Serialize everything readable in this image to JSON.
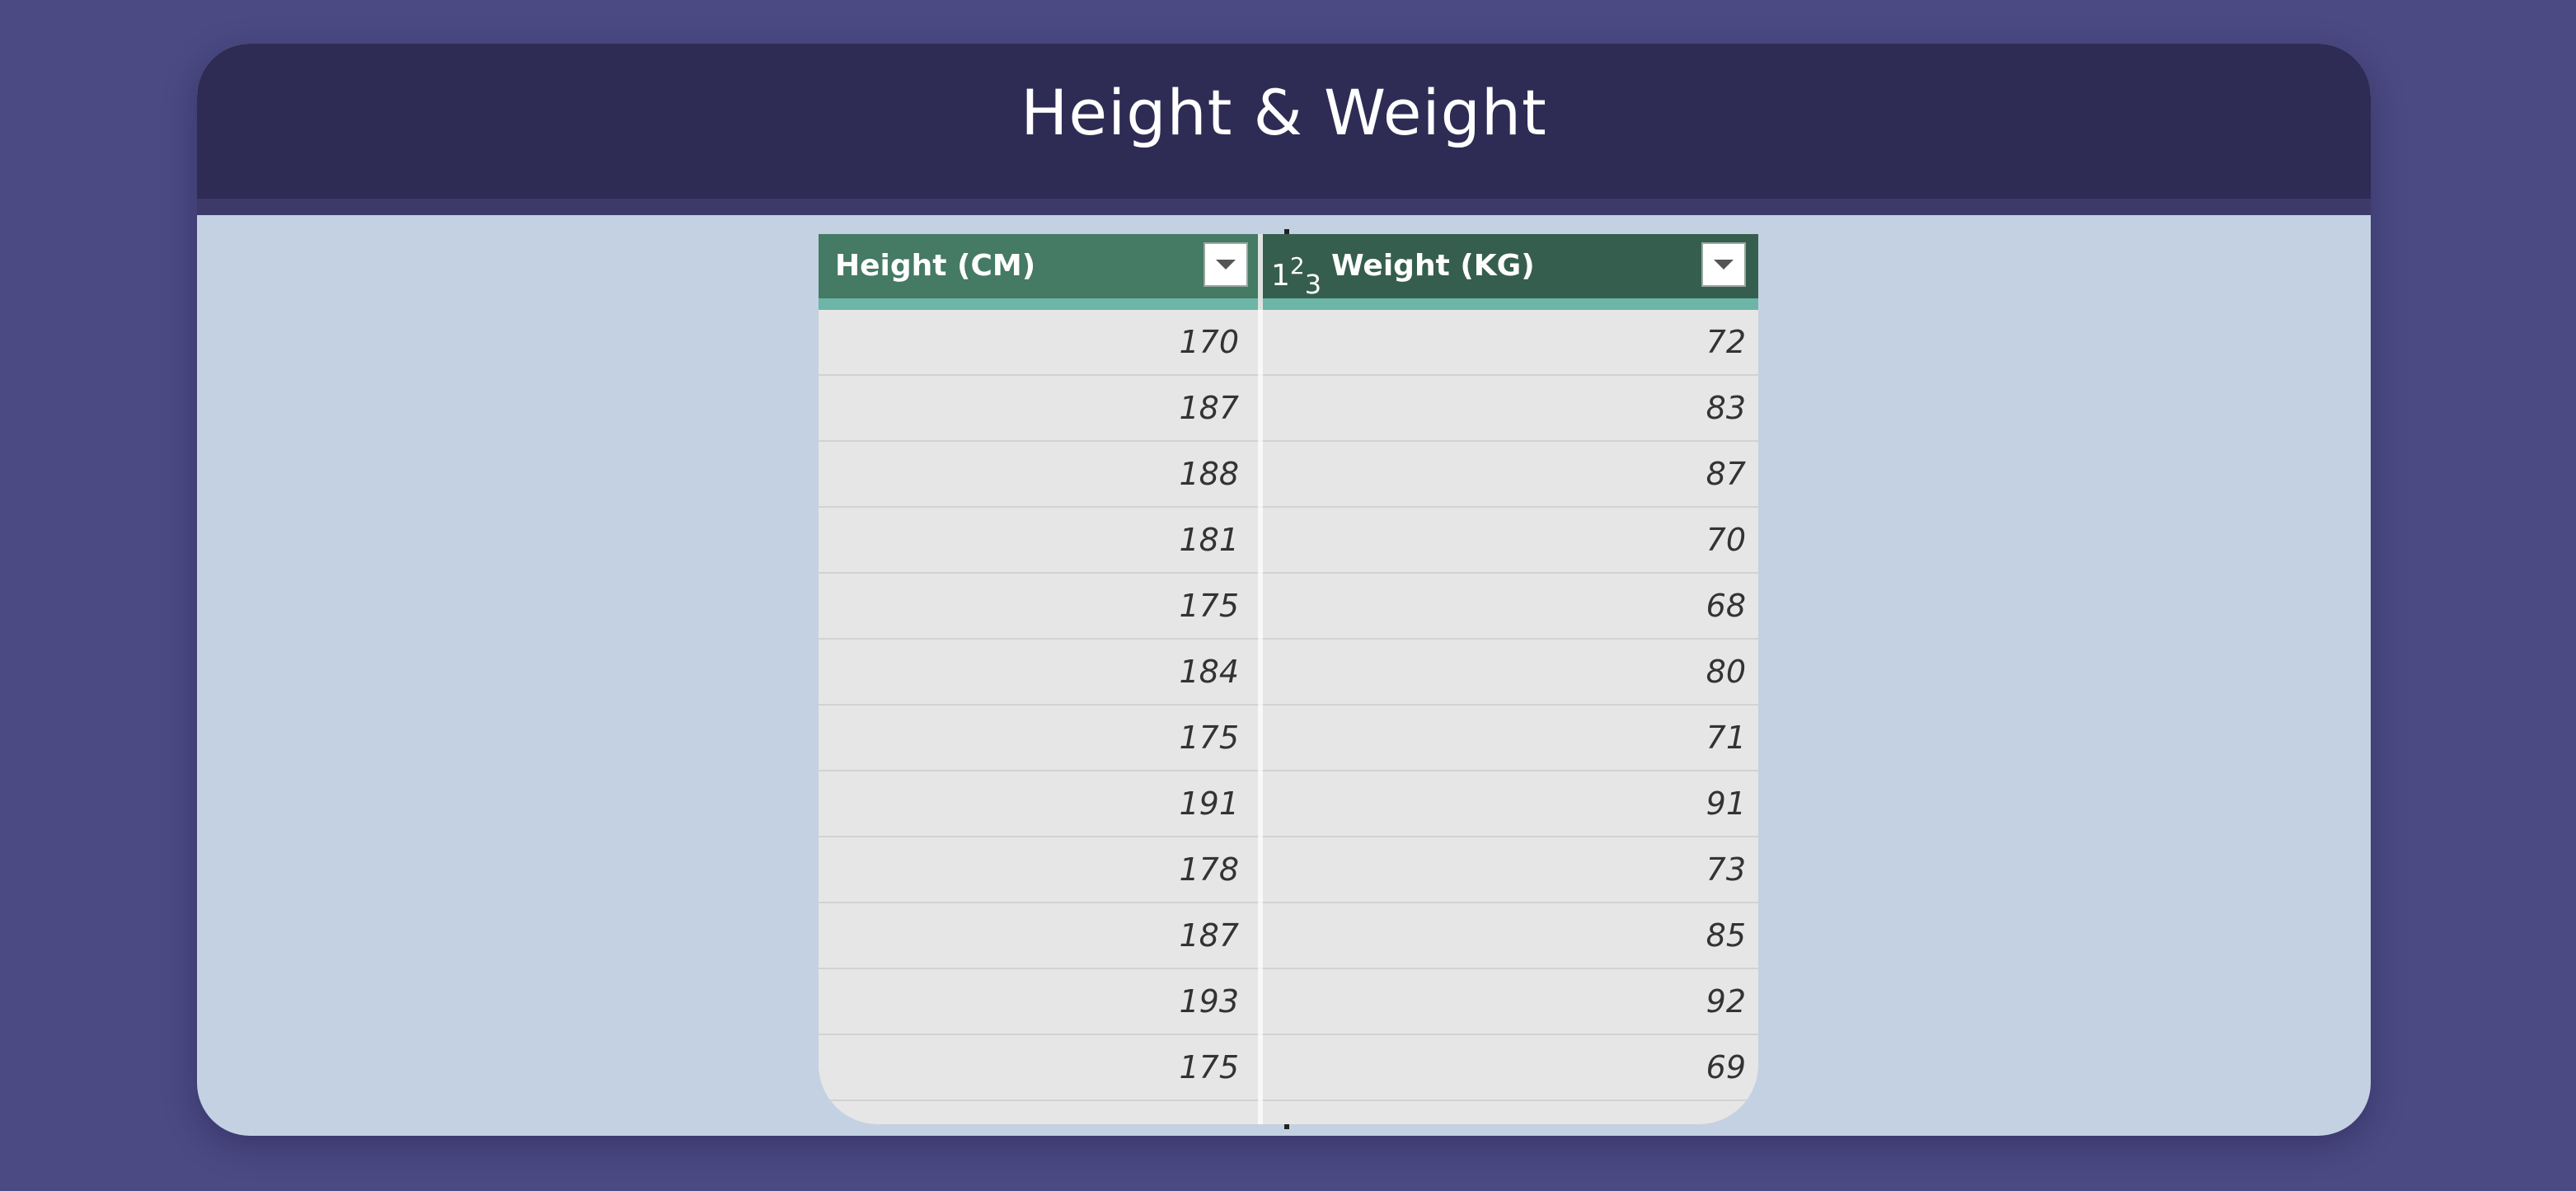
{
  "title": "Height & Weight",
  "table": {
    "columns": [
      {
        "label": "Height (CM)",
        "type_icon": ""
      },
      {
        "label": "Weight (KG)",
        "type_icon": "123"
      }
    ],
    "rows": [
      {
        "height": "170",
        "weight": "72"
      },
      {
        "height": "187",
        "weight": "83"
      },
      {
        "height": "188",
        "weight": "87"
      },
      {
        "height": "181",
        "weight": "70"
      },
      {
        "height": "175",
        "weight": "68"
      },
      {
        "height": "184",
        "weight": "80"
      },
      {
        "height": "175",
        "weight": "71"
      },
      {
        "height": "191",
        "weight": "91"
      },
      {
        "height": "178",
        "weight": "73"
      },
      {
        "height": "187",
        "weight": "85"
      },
      {
        "height": "193",
        "weight": "92"
      },
      {
        "height": "175",
        "weight": "69"
      }
    ]
  },
  "icons": {
    "filter": "chevron-down-icon",
    "number_type": "whole-number-type-icon"
  }
}
